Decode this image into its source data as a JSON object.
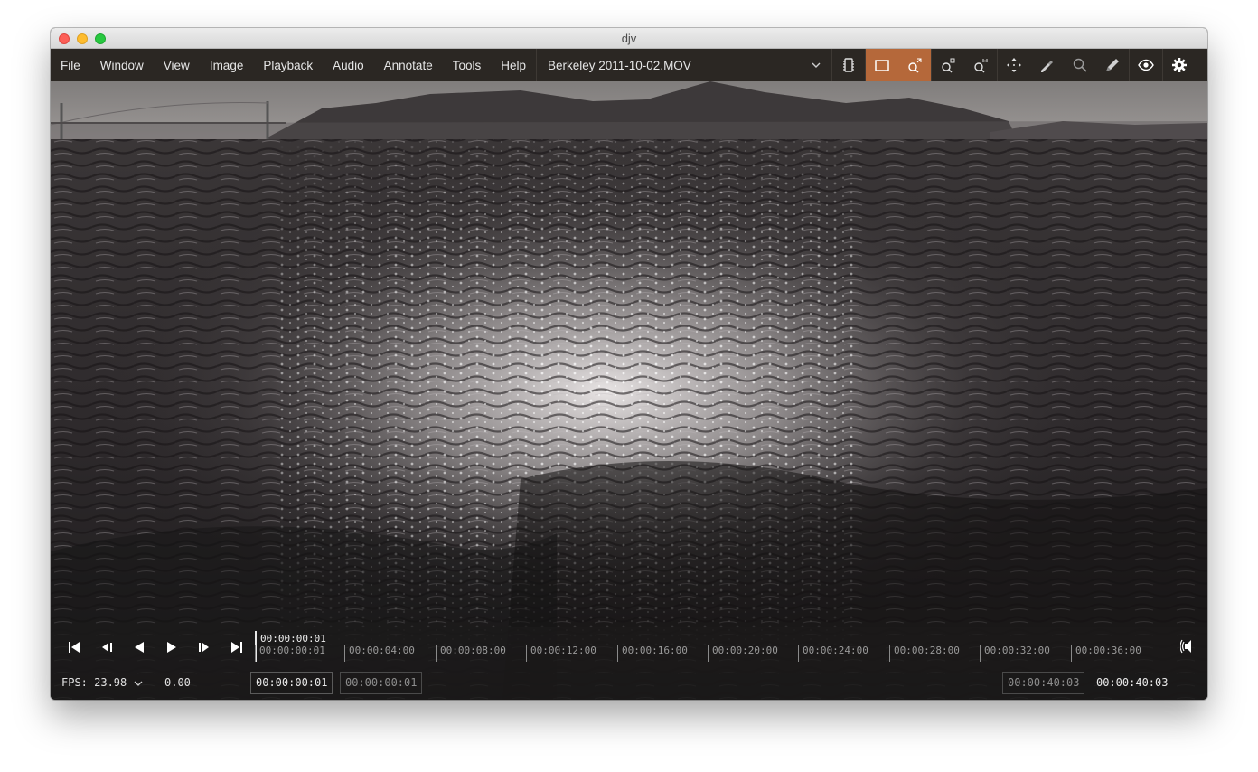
{
  "window": {
    "title": "djv"
  },
  "menu": {
    "items": [
      "File",
      "Window",
      "View",
      "Image",
      "Playback",
      "Audio",
      "Annotate",
      "Tools",
      "Help"
    ]
  },
  "file_select": {
    "value": "Berkeley 2011-10-02.MOV"
  },
  "toolbar": {
    "tools": [
      {
        "name": "memory-cache-icon",
        "active": false
      },
      {
        "name": "fill-window-icon",
        "active": true
      },
      {
        "name": "zoom-fit-icon",
        "active": true
      },
      {
        "name": "zoom-frame-icon",
        "active": false
      },
      {
        "name": "zoom-1-1-icon",
        "active": false
      },
      {
        "name": "pan-move-icon",
        "active": false
      },
      {
        "name": "color-picker-icon",
        "active": false
      },
      {
        "name": "magnify-icon",
        "active": false
      },
      {
        "name": "annotate-pen-icon",
        "active": false
      },
      {
        "name": "view-eye-icon",
        "active": false
      },
      {
        "name": "settings-gear-icon",
        "active": false
      }
    ],
    "accent_color": "#b5683a"
  },
  "playback": {
    "current_time": "00:00:00:01",
    "timeline_ticks": [
      "00:00:00:01",
      "00:00:04:00",
      "00:00:08:00",
      "00:00:12:00",
      "00:00:16:00",
      "00:00:20:00",
      "00:00:24:00",
      "00:00:28:00",
      "00:00:32:00",
      "00:00:36:00"
    ],
    "fps_label": "FPS: 23.98",
    "speed": "0.00",
    "in_point": "00:00:00:01",
    "out_point": "00:00:00:01",
    "duration": "00:00:40:03",
    "end_time": "00:00:40:03"
  }
}
